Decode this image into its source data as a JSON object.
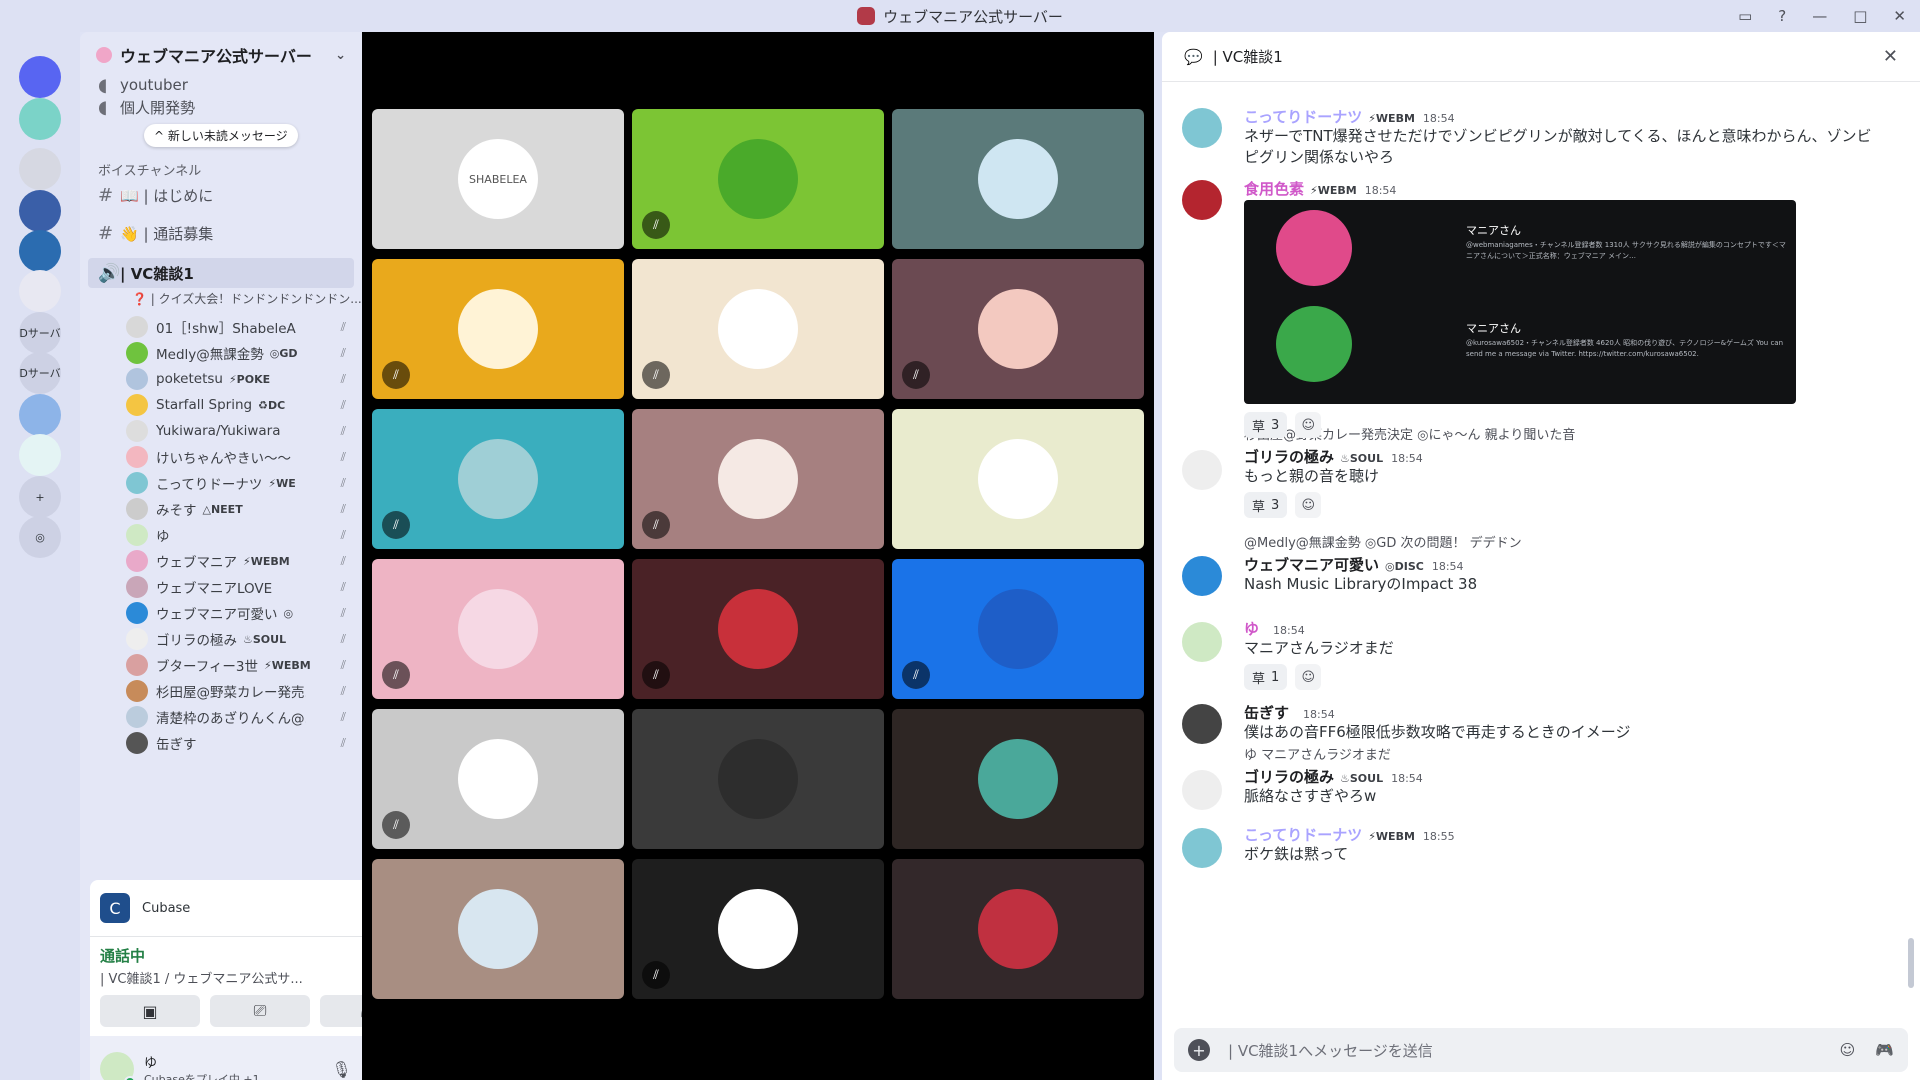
{
  "window": {
    "title": "ウェブマニア公式サーバー",
    "icons": [
      "inbox-icon",
      "help-icon",
      "minimize-icon",
      "maximize-icon",
      "close-icon"
    ]
  },
  "rail": {
    "items": [
      {
        "label": "",
        "color": "#5865f2"
      },
      {
        "label": "",
        "color": "#7bd3c8"
      },
      {
        "label": "",
        "color": "#d6d8e2"
      },
      {
        "label": "",
        "color": "#3a5fa8"
      },
      {
        "label": "",
        "color": "#2b6cb0"
      },
      {
        "label": "",
        "color": "#e8e8f2"
      },
      {
        "label": "Dサーバ",
        "color": "#cdd1e4"
      },
      {
        "label": "Dサーバ",
        "color": "#cdd1e4"
      },
      {
        "label": "",
        "color": "#8db4e8"
      },
      {
        "label": "",
        "color": "#e4f4f4"
      },
      {
        "label": "+",
        "color": "#cdd1e4"
      },
      {
        "label": "◎",
        "color": "#cdd1e4"
      }
    ]
  },
  "sidebar": {
    "server_name": "ウェブマニア公式サーバー",
    "top_channels": [
      "youtuber",
      "個人開発勢"
    ],
    "unread_pill": "^ 新しい未読メッセージ",
    "category": "ボイスチャンネル",
    "text_channels": [
      "📖 | はじめに",
      "👋 | 通話募集"
    ],
    "active_vc": "| VC雑談1",
    "vc_status": "❓ | クイズ大会！ドンドンドンドンドン...",
    "members": [
      {
        "name": "01［!shw］ShabeleA",
        "tag": "",
        "color": "#d8d8d8"
      },
      {
        "name": "Medly@無課金勢",
        "tag": "◎GD",
        "color": "#6fc33e"
      },
      {
        "name": "poketetsu",
        "tag": "⚡POKE",
        "color": "#b0c4de"
      },
      {
        "name": "Starfall Spring",
        "tag": "♻DC",
        "color": "#f4c542"
      },
      {
        "name": "Yukiwara/Yukiwara",
        "tag": "",
        "color": "#ddd"
      },
      {
        "name": "けいちゃんやきい〜〜",
        "tag": "",
        "color": "#f3b7c0"
      },
      {
        "name": "こってりドーナツ",
        "tag": "⚡WE",
        "color": "#7fc6d3"
      },
      {
        "name": "みそす",
        "tag": "△NEET",
        "color": "#ccc"
      },
      {
        "name": "ゆ",
        "tag": "",
        "color": "#cfe9c4"
      },
      {
        "name": "ウェブマニア",
        "tag": "⚡WEBM",
        "color": "#e9a9c9"
      },
      {
        "name": "ウェブマニアLOVE",
        "tag": "",
        "color": "#c9a6b8"
      },
      {
        "name": "ウェブマニア可愛い",
        "tag": "◎",
        "color": "#2b8ad8"
      },
      {
        "name": "ゴリラの極み",
        "tag": "♨SOUL",
        "color": "#eee"
      },
      {
        "name": "ブターフィー3世",
        "tag": "⚡WEBM",
        "color": "#d9a0a0"
      },
      {
        "name": "杉田屋@野菜カレー発売...",
        "tag": "",
        "color": "#c78b5a"
      },
      {
        "name": "清楚枠のあざりんくん@...",
        "tag": "",
        "color": "#bcd"
      },
      {
        "name": "缶ぎす",
        "tag": "",
        "color": "#555"
      }
    ]
  },
  "activity": {
    "app": "Cubase"
  },
  "voice": {
    "status": "通話中",
    "channel": "| VC雑談1 / ウェブマニア公式サ..."
  },
  "user": {
    "name": "ゆ",
    "activity": "Cubaseをプレイ中 +1"
  },
  "stage": {
    "tiles": [
      {
        "bg": "#d9d9d9",
        "avatar": "#ffffff",
        "label": "SHABELEA",
        "muted": false
      },
      {
        "bg": "#7cc534",
        "avatar": "#4aaa2a",
        "label": "",
        "muted": true
      },
      {
        "bg": "#5b7a7a",
        "avatar": "#cfe6f2",
        "label": "",
        "muted": false
      },
      {
        "bg": "#e9a91c",
        "avatar": "#fff3d6",
        "label": "",
        "muted": true
      },
      {
        "bg": "#f2e5d0",
        "avatar": "#ffffff",
        "label": "",
        "muted": true
      },
      {
        "bg": "#6b4a52",
        "avatar": "#f3c9c0",
        "label": "",
        "muted": true
      },
      {
        "bg": "#3aaebe",
        "avatar": "#9fcfd6",
        "label": "",
        "muted": true
      },
      {
        "bg": "#a68080",
        "avatar": "#f5e9e4",
        "label": "",
        "muted": true
      },
      {
        "bg": "#e9ebce",
        "avatar": "#ffffff",
        "label": "",
        "muted": false
      },
      {
        "bg": "#eeb4c4",
        "avatar": "#f6d8e4",
        "label": "",
        "muted": true
      },
      {
        "bg": "#4a2226",
        "avatar": "#c8303a",
        "label": "",
        "muted": true
      },
      {
        "bg": "#1a73e8",
        "avatar": "#1e5ec8",
        "label": "",
        "muted": true
      },
      {
        "bg": "#c9c9c9",
        "avatar": "#ffffff",
        "label": "",
        "muted": true
      },
      {
        "bg": "#3a3a3a",
        "avatar": "#2d2d2d",
        "label": "",
        "muted": false
      },
      {
        "bg": "#2e2624",
        "avatar": "#4aa89a",
        "label": "",
        "muted": false
      },
      {
        "bg": "#a88e82",
        "avatar": "#d8e6f0",
        "label": "",
        "muted": false
      },
      {
        "bg": "#1e1e1e",
        "avatar": "#ffffff",
        "label": "",
        "muted": true
      },
      {
        "bg": "#33282a",
        "avatar": "#c03040",
        "label": "",
        "muted": false
      }
    ]
  },
  "chat": {
    "title": "| VC雑談1",
    "placeholder": "| VC雑談1へメッセージを送信",
    "messages": [
      {
        "name": "こってりドーナツ",
        "name_color": "#a9a3ff",
        "badge": "⚡WEBM",
        "time": "18:54",
        "body": "ネザーでTNT爆発させただけでゾンビピグリンが敵対してくる、ほんと意味わからん、ゾンビピグリン関係ないやろ",
        "avatar": "#7fc6d3"
      },
      {
        "name": "食用色素",
        "name_color": "#d058c9",
        "badge": "⚡WEBM",
        "time": "18:54",
        "body": "",
        "avatar": "#b4252f"
      },
      {
        "name": "ゴリラの極み",
        "name_color": "#1e1f22",
        "badge": "♨SOUL",
        "time": "18:54",
        "body": "もっと親の音を聴け",
        "avatar": "#eeeeee",
        "reply": "杉田屋@野菜カレー発売決定 ◎にゃ〜ん 親より聞いた音"
      },
      {
        "name": "ウェブマニア可愛い",
        "name_color": "#1e1f22",
        "badge": "◎DISC",
        "time": "18:54",
        "body": "Nash Music LibraryのImpact 38",
        "avatar": "#2b8ad8",
        "reply": "@Medly@無課金勢 ◎GD 次の問題！ デデドン"
      },
      {
        "name": "ゆ",
        "name_color": "#d058c9",
        "badge": "",
        "time": "18:54",
        "body": "マニアさんラジオまだ",
        "avatar": "#cfe9c4"
      },
      {
        "name": "缶ぎす",
        "name_color": "#1e1f22",
        "badge": "",
        "time": "18:54",
        "body": "僕はあの音FF6極限低歩数攻略で再走するときのイメージ",
        "avatar": "#444444"
      },
      {
        "name": "ゴリラの極み",
        "name_color": "#1e1f22",
        "badge": "♨SOUL",
        "time": "18:54",
        "body": "脈絡なさすぎやろw",
        "avatar": "#eeeeee",
        "reply": "ゆ マニアさんラジオまだ"
      },
      {
        "name": "こってりドーナツ",
        "name_color": "#a9a3ff",
        "badge": "⚡WEBM",
        "time": "18:55",
        "body": "ボケ鉄は黙って",
        "avatar": "#7fc6d3"
      }
    ],
    "reactions": [
      "3",
      "3",
      "1"
    ],
    "embed": {
      "title1": "マニアさん",
      "desc1": "@webmaniagames・チャンネル登録者数 1310人 サクサク見れる解説が編集のコンセプトです＜マニアさんについて＞正式名称：ウェブマニア メイン…",
      "title2": "マニアさん",
      "desc2": "@kurosawa6502・チャンネル登録者数 4620人 昭和の伐り遊び、テクノロジー&ゲームズ You can send me a message via Twitter. https://twitter.com/kurosawa6502."
    }
  }
}
